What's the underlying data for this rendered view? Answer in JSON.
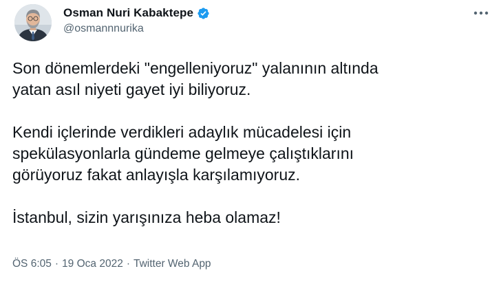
{
  "author": {
    "display_name": "Osman Nuri Kabaktepe",
    "handle": "@osmannnurika",
    "verified_icon": "verified-badge-icon",
    "avatar_icon": "profile-photo",
    "colors": {
      "verified": "#1d9bf0",
      "secondary_text": "#536471",
      "primary_text": "#0f1419"
    }
  },
  "tweet": {
    "paragraphs": [
      {
        "lines": [
          "Son dönemlerdeki \"engelleniyoruz\" yalanının altında",
          "yatan asıl niyeti gayet iyi biliyoruz."
        ]
      },
      {
        "lines": [
          "Kendi içlerinde verdikleri adaylık mücadelesi için",
          "spekülasyonlarla gündeme gelmeye çalıştıklarını",
          "görüyoruz fakat anlayışla karşılamıyoruz."
        ]
      },
      {
        "lines": [
          "İstanbul, sizin yarışınıza heba olamaz!"
        ]
      }
    ]
  },
  "meta": {
    "time": "ÖS 6:05",
    "separator": "·",
    "date": "19 Oca 2022",
    "source": "Twitter Web App"
  },
  "more_icon": "more-horizontal-icon"
}
